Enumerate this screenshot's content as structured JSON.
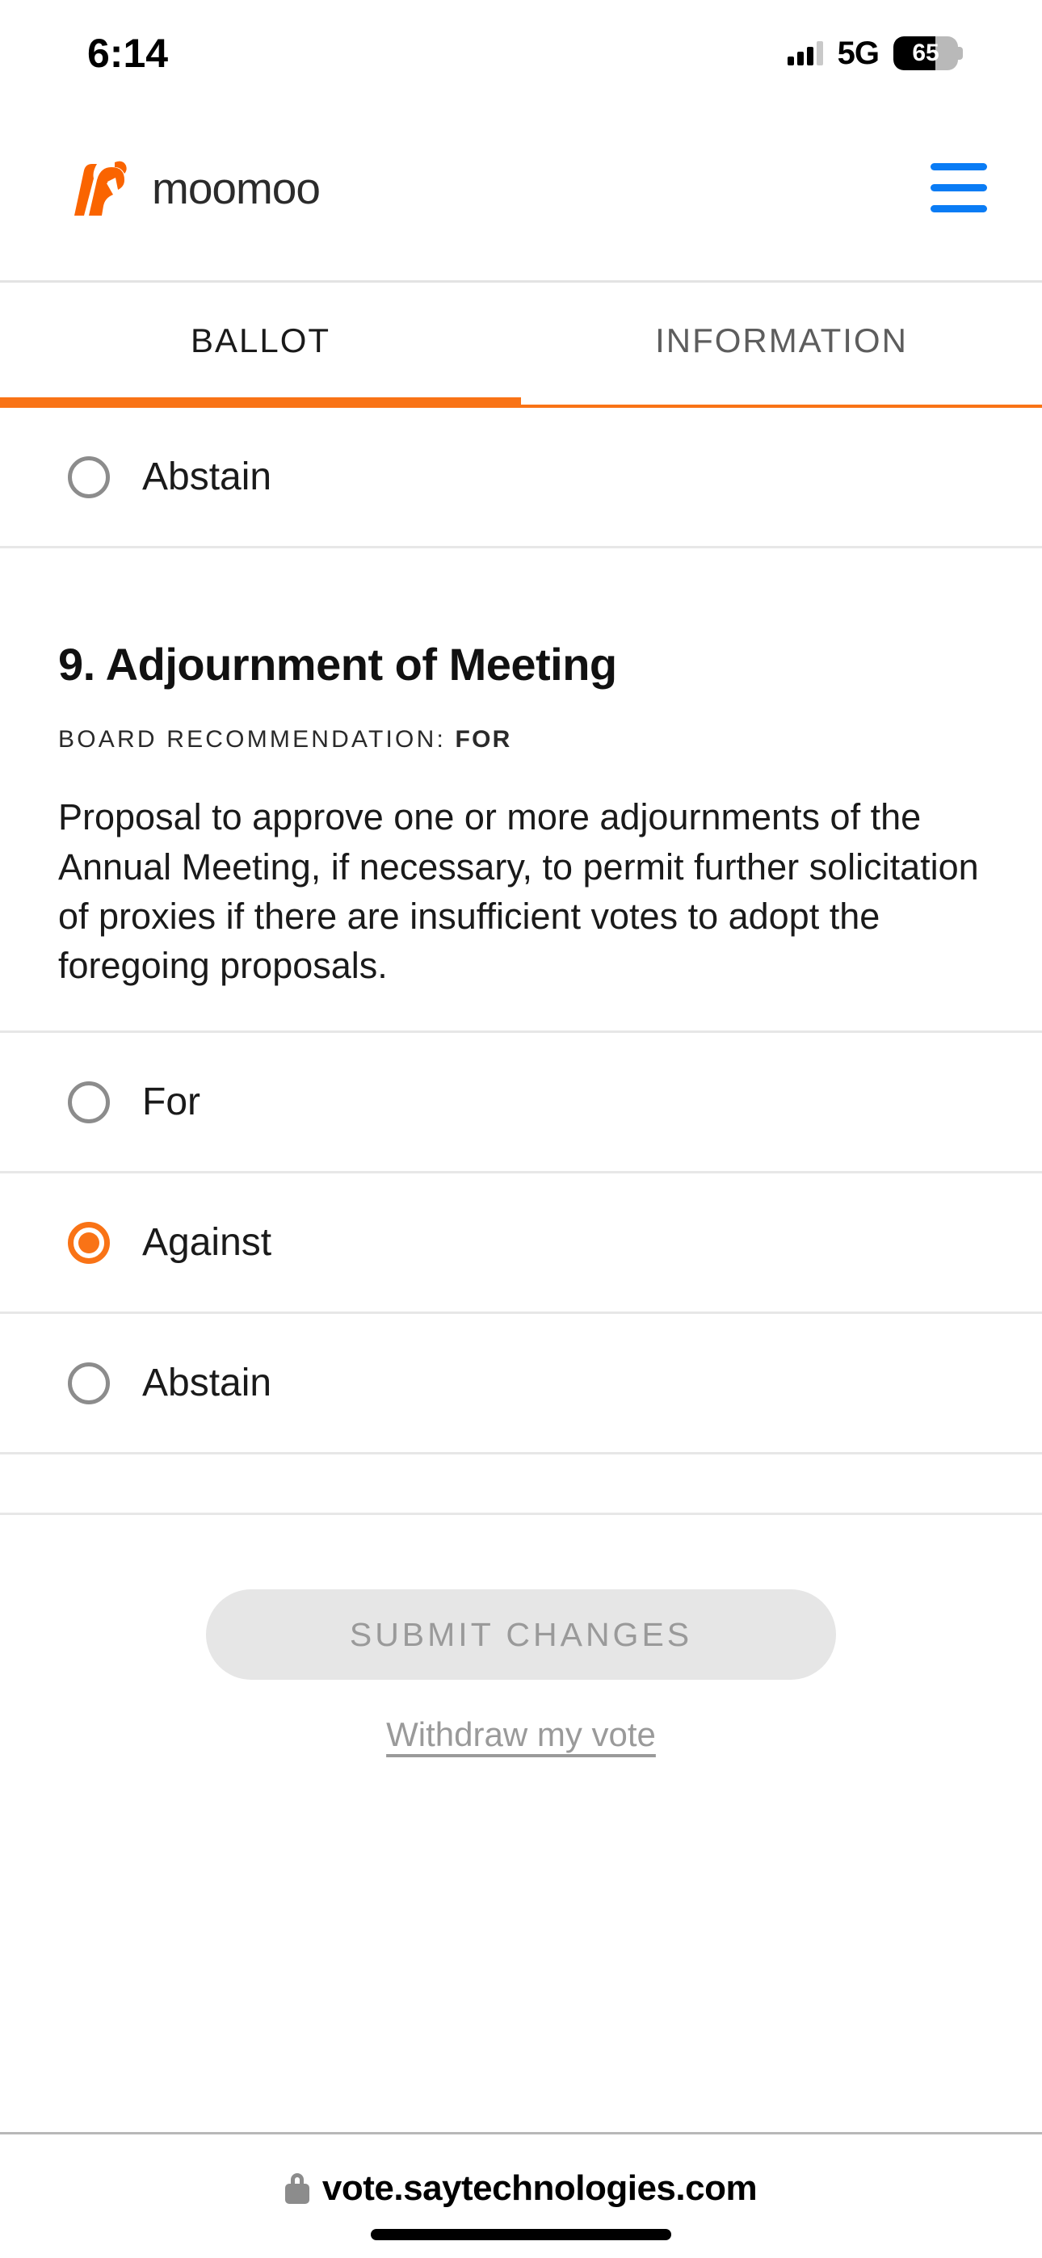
{
  "status_bar": {
    "time": "6:14",
    "network": "5G",
    "battery_percent": "65",
    "battery_level": 65,
    "signal_icon": "signal-bars-icon",
    "battery_icon": "battery-icon"
  },
  "header": {
    "brand_name": "moomoo",
    "logo_icon": "moomoo-bull-logo-icon",
    "menu_icon": "hamburger-menu-icon",
    "menu_color": "#0a7cf5"
  },
  "tabs": {
    "active_index": 0,
    "accent_color": "#f97316",
    "items": [
      {
        "label": "BALLOT"
      },
      {
        "label": "INFORMATION"
      }
    ]
  },
  "previous_proposal": {
    "options": [
      {
        "label": "Abstain",
        "selected": false
      }
    ]
  },
  "proposal": {
    "title": "9. Adjournment of Meeting",
    "recommendation_label": "Board Recommendation:",
    "recommendation_value": "FOR",
    "body": "Proposal to approve one or more adjournments of the Annual Meeting, if necessary, to permit further solicitation of proxies if there are insufficient votes to adopt the foregoing proposals.",
    "options": [
      {
        "label": "For",
        "selected": false
      },
      {
        "label": "Against",
        "selected": true
      },
      {
        "label": "Abstain",
        "selected": false
      }
    ]
  },
  "actions": {
    "submit_label": "SUBMIT CHANGES",
    "submit_enabled": false,
    "withdraw_label": "Withdraw my vote"
  },
  "browser": {
    "url": "vote.saytechnologies.com",
    "lock_icon": "lock-icon",
    "home_indicator_icon": "home-indicator"
  }
}
